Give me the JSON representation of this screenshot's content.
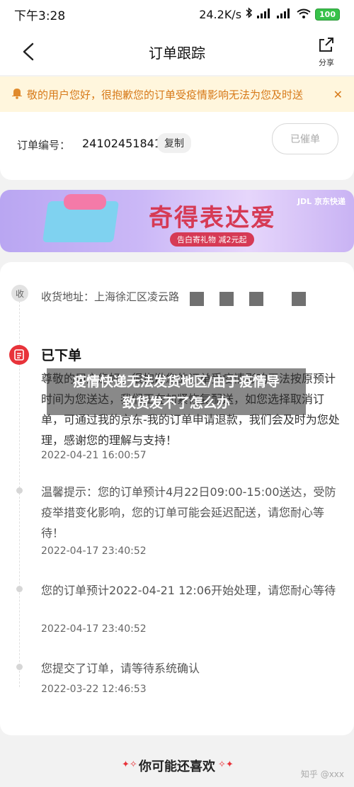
{
  "status_bar": {
    "time": "下午3:28",
    "network_speed": "24.2K/s",
    "bluetooth_icon": "bluetooth-icon",
    "signal_icon": "signal-icon",
    "wifi_icon": "wifi-icon",
    "battery": "100"
  },
  "nav": {
    "title": "订单跟踪",
    "share_label": "分享",
    "back_icon": "back-arrow-icon",
    "share_icon": "share-icon"
  },
  "notice": {
    "icon": "bell-icon",
    "text": "敬的用户您好，很抱歉您的订单受疫情影响无法为您及时送",
    "close_icon": "close-icon",
    "color": "#d77a1a"
  },
  "order": {
    "label": "订单编号：",
    "number": "241024518414",
    "copy_label": "复制",
    "urge_label": "已催单"
  },
  "banner": {
    "slogan": "奇得表达爱",
    "sub": "告白寄礼物 减2元起",
    "brand": "JDL 京东快递",
    "accent": "#d63a55"
  },
  "timeline": {
    "address_icon_label": "收",
    "address": "收货地址：上海徐汇区凌云路",
    "placed_title": "已下单",
    "events": [
      {
        "text": "尊敬的用户您好，很抱歉您的订单受疫情影响无法按原预计时间为您送达，我们正在加紧恢复配送，如您选择取消订单，可通过我的京东-我的订单申请退款，我们会及时为您处理，感谢您的理解与支持！",
        "time": "2022-04-21 16:00:57"
      },
      {
        "text": "温馨提示：您的订单预计4月22日09:00-15:00送达，受防疫举措变化影响，您的订单可能会延迟配送，请您耐心等待！",
        "time": "2022-04-17 23:40:52"
      },
      {
        "text": "您的订单预计2022-04-21 12:06开始处理，请您耐心等待",
        "time": "2022-04-17 23:40:52"
      },
      {
        "text": "您提交了订单，请等待系统确认",
        "time": "2022-03-22 12:46:53"
      }
    ]
  },
  "overlay": {
    "line1": "疫情快递无法发货地区/由于疫情导",
    "line2": "致货发不了怎么办"
  },
  "recommend": {
    "title": "你可能还喜欢"
  },
  "watermark": "知乎 @xxx",
  "colors": {
    "primary_red": "#e8333a",
    "background": "#f2f2f2"
  }
}
